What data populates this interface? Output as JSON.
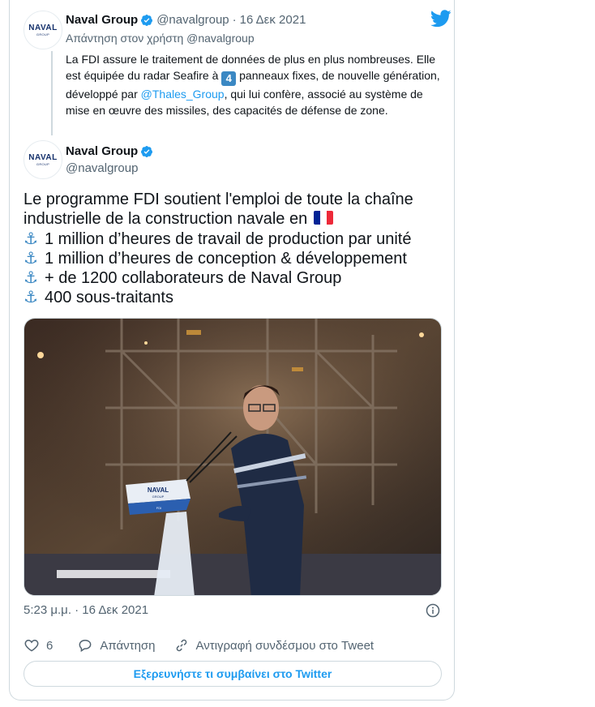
{
  "parent_tweet": {
    "author_name": "Naval Group",
    "author_handle": "@navalgroup",
    "separator": "·",
    "date": "16 Δεκ 2021",
    "reply_to": "Απάντηση στον χρήστη @navalgroup",
    "text_part1": "La FDI assure le traitement de données de plus en plus nombreuses. Elle est équipée du radar Seafire à ",
    "keycap_number": "4",
    "text_part2": " panneaux fixes, de nouvelle génération, développé par ",
    "mention": "@Thales_Group",
    "text_part3": ", qui lui confère, associé au système de mise en œuvre des missiles, des capacités de défense de zone."
  },
  "avatar_logo": {
    "word": "NAVAL",
    "sub": "GROUP"
  },
  "main_tweet": {
    "author_name": "Naval Group",
    "author_handle": "@navalgroup",
    "line1": "Le programme FDI soutient l'emploi de toute la chaîne",
    "line2": "industrielle de la construction navale en ",
    "bullet_icon": "⚓",
    "bullets": [
      "1 million d’heures de travail de production par unité",
      "1 million d’heures de conception & développement",
      "+ de 1200 collaborateurs de Naval Group",
      "400 sous-traitants"
    ],
    "flag_colors": [
      "#002395",
      "#ffffff",
      "#ed2939"
    ],
    "timestamp": "5:23 μ.μ. · 16 Δεκ 2021",
    "like_count": "6",
    "reply_label": "Απάντηση",
    "copy_link_label": "Αντιγραφή συνδέσμου στο Tweet",
    "explore_label": "Εξερευνήστε τι συμβαίνει στο Twitter"
  },
  "photo": {
    "lectern_logo_word": "NAVAL",
    "lectern_logo_sub": "GROUP",
    "lectern_caption": "FDI"
  },
  "colors": {
    "twitter_blue": "#1d9bf0",
    "text_primary": "#0f1419",
    "text_secondary": "#536471",
    "border": "#cfd9de"
  }
}
